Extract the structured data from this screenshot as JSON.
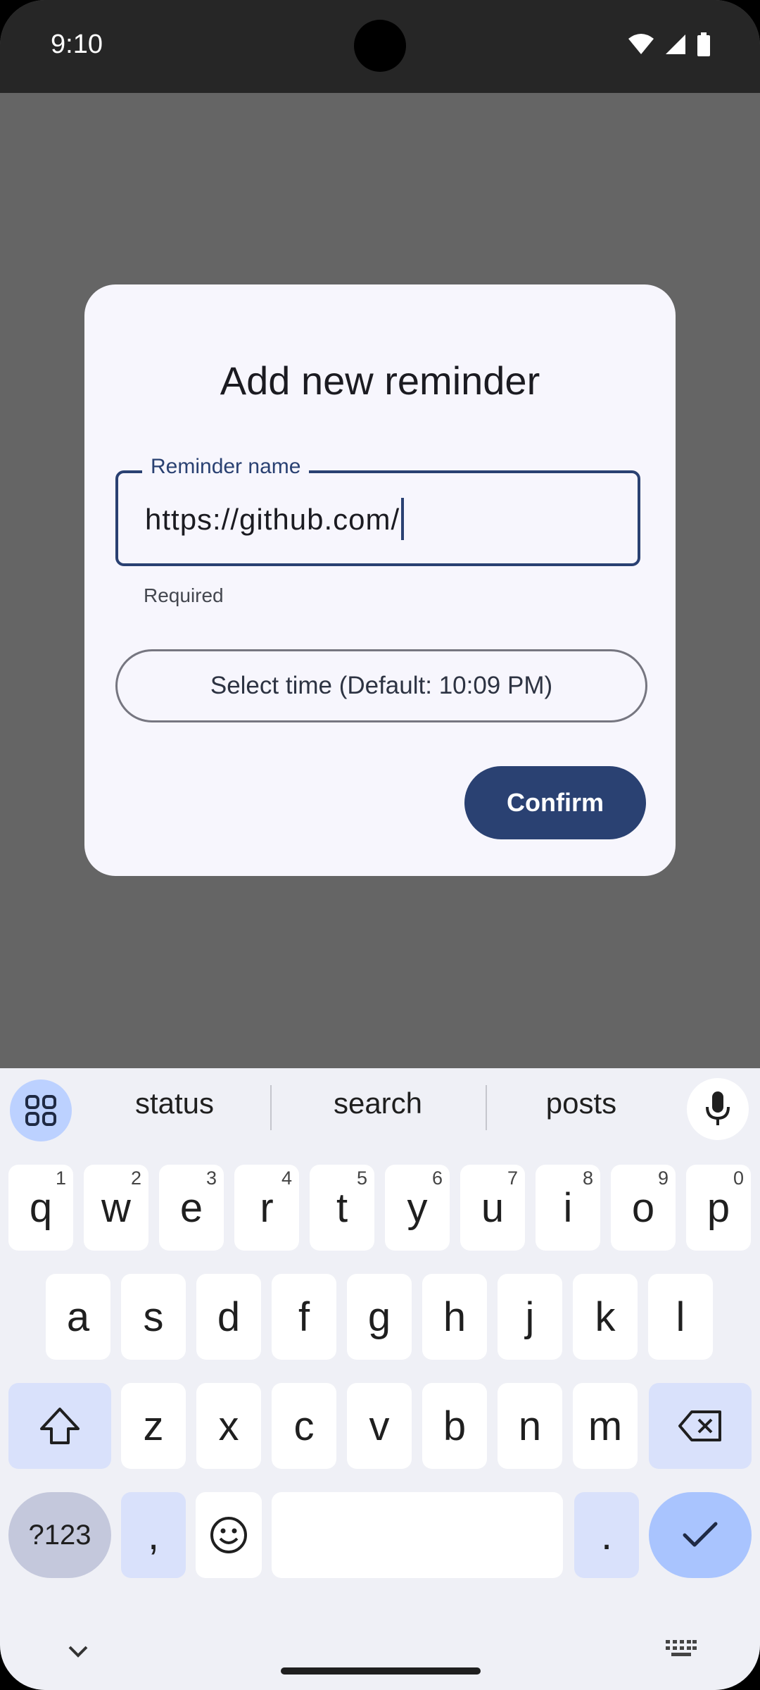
{
  "status_bar": {
    "time": "9:10"
  },
  "dialog": {
    "title": "Add new reminder",
    "field": {
      "label": "Reminder name",
      "value": "https://github.com/",
      "support_text": "Required"
    },
    "time_button": "Select time (Default: 10:09 PM)",
    "confirm_button": "Confirm"
  },
  "keyboard": {
    "suggestions": [
      "status",
      "search",
      "posts"
    ],
    "row1": [
      {
        "k": "q",
        "h": "1"
      },
      {
        "k": "w",
        "h": "2"
      },
      {
        "k": "e",
        "h": "3"
      },
      {
        "k": "r",
        "h": "4"
      },
      {
        "k": "t",
        "h": "5"
      },
      {
        "k": "y",
        "h": "6"
      },
      {
        "k": "u",
        "h": "7"
      },
      {
        "k": "i",
        "h": "8"
      },
      {
        "k": "o",
        "h": "9"
      },
      {
        "k": "p",
        "h": "0"
      }
    ],
    "row2": [
      "a",
      "s",
      "d",
      "f",
      "g",
      "h",
      "j",
      "k",
      "l"
    ],
    "row3": [
      "z",
      "x",
      "c",
      "v",
      "b",
      "n",
      "m"
    ],
    "sym_label": "?123",
    "comma": ",",
    "period": "."
  },
  "colors": {
    "primary": "#2a4172",
    "dialog_bg": "#f7f6fd",
    "scrim": "#656565",
    "keyboard_bg": "#eff0f6"
  }
}
